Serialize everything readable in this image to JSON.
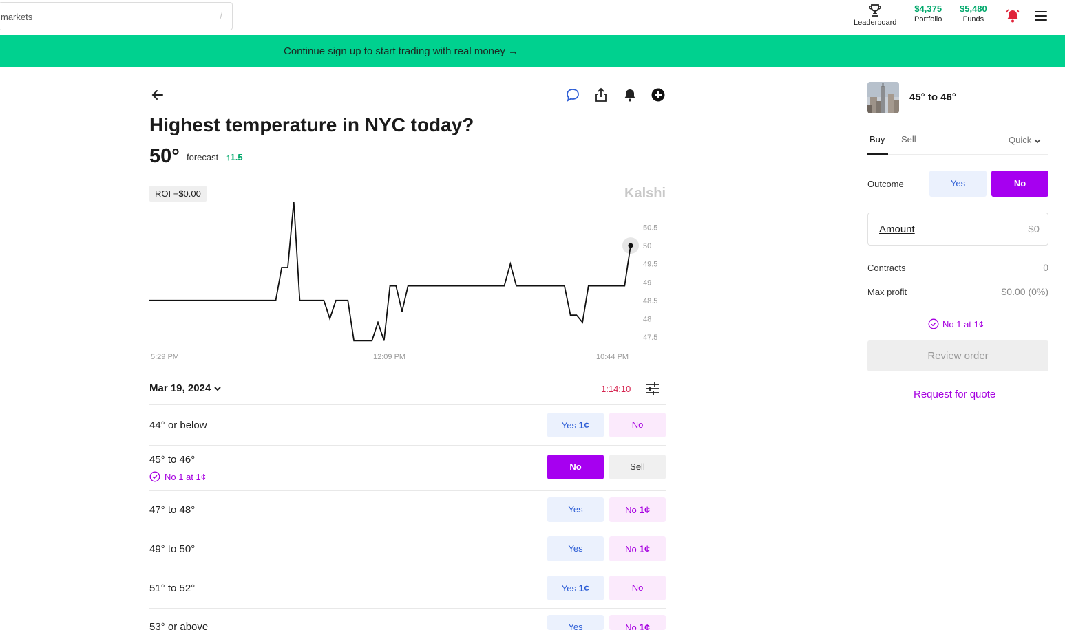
{
  "topbar": {
    "search_placeholder": "markets",
    "search_shortcut": "/",
    "leaderboard_label": "Leaderboard",
    "portfolio_value": "$4,375",
    "portfolio_label": "Portfolio",
    "funds_value": "$5,480",
    "funds_label": "Funds"
  },
  "banner": {
    "text": "Continue sign up to start trading with real money →"
  },
  "market": {
    "title": "Highest temperature in NYC today?",
    "forecast_value": "50°",
    "forecast_label": "forecast",
    "forecast_change": "↑1.5",
    "roi": "ROI +$0.00",
    "brand": "Kalshi"
  },
  "chart_data": {
    "type": "line",
    "x_ticks": [
      "5:29 PM",
      "12:09 PM",
      "10:44 PM"
    ],
    "y_ticks": [
      "50.5",
      "50",
      "49.5",
      "49",
      "48.5",
      "48",
      "47.5"
    ],
    "ylim": [
      47.5,
      50.5
    ],
    "series": [
      {
        "values": [
          48.5,
          48.5,
          48.5,
          48.5,
          48.5,
          48.5,
          48.5,
          48.5,
          48.5,
          48.5,
          48.5,
          48.5,
          48.5,
          48.5,
          48.5,
          48.5,
          48.5,
          48.5,
          48.5,
          48.5,
          48.5,
          48.5,
          49.4,
          49.4,
          51.2,
          48.5,
          48.5,
          48.5,
          48.5,
          48.5,
          48.0,
          48.5,
          48.5,
          48.5,
          47.4,
          47.4,
          47.4,
          47.4,
          47.9,
          47.4,
          48.9,
          48.9,
          48.2,
          48.9,
          48.9,
          48.9,
          48.9,
          48.9,
          48.9,
          48.9,
          48.9,
          48.9,
          48.9,
          48.9,
          48.9,
          48.9,
          48.9,
          48.9,
          48.9,
          48.9,
          49.5,
          48.9,
          48.9,
          48.9,
          48.9,
          48.9,
          48.9,
          48.9,
          48.9,
          48.9,
          48.1,
          48.1,
          47.9,
          48.9,
          48.9,
          48.9,
          48.9,
          48.9,
          48.9,
          48.9,
          50.0
        ]
      }
    ],
    "grid": false,
    "legend": "none"
  },
  "controls": {
    "date": "Mar 19, 2024",
    "timer": "1:14:10"
  },
  "rows": [
    {
      "label": "44° or below",
      "yes": "Yes",
      "yes_price": "1¢",
      "no": "No",
      "no_price": ""
    },
    {
      "label": "45° to 46°",
      "sub": "No 1 at 1¢",
      "no": "No",
      "sell": "Sell"
    },
    {
      "label": "47° to 48°",
      "yes": "Yes",
      "yes_price": "",
      "no": "No",
      "no_price": "1¢"
    },
    {
      "label": "49° to 50°",
      "yes": "Yes",
      "yes_price": "",
      "no": "No",
      "no_price": "1¢"
    },
    {
      "label": "51° to 52°",
      "yes": "Yes",
      "yes_price": "1¢",
      "no": "No",
      "no_price": ""
    },
    {
      "label": "53° or above",
      "yes": "Yes",
      "yes_price": "",
      "no": "No",
      "no_price": "1¢"
    }
  ],
  "panel": {
    "title": "45° to 46°",
    "tab_buy": "Buy",
    "tab_sell": "Sell",
    "mode": "Quick",
    "outcome_label": "Outcome",
    "outcome_yes": "Yes",
    "outcome_no": "No",
    "amount_label": "Amount",
    "amount_placeholder": "$0",
    "contracts_label": "Contracts",
    "contracts_value": "0",
    "max_profit_label": "Max profit",
    "max_profit_value": "$0.00 (0%)",
    "position": "No 1 at 1¢",
    "review_button": "Review order",
    "rfq_link": "Request for quote"
  },
  "colors": {
    "accent_green": "#00d18f",
    "purple": "#a600f0",
    "blue": "#2f5fd6",
    "red": "#d6234f"
  }
}
